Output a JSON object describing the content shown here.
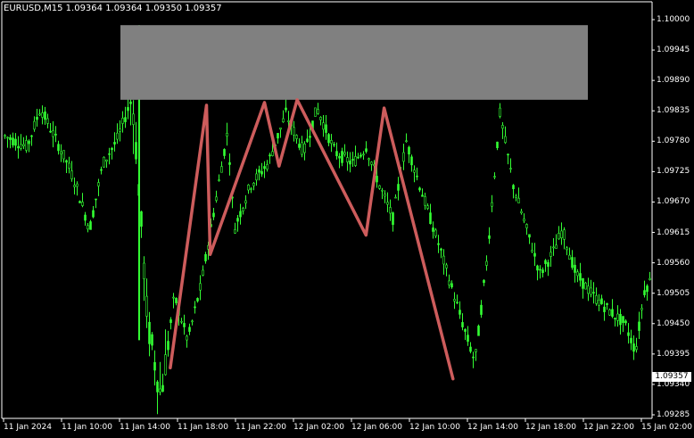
{
  "symbol_info": {
    "text": "EURUSD,M15  1.09364 1.09364 1.09350 1.09357"
  },
  "price_axis": {
    "ticks": [
      "1.10000",
      "1.09945",
      "1.09890",
      "1.09835",
      "1.09780",
      "1.09725",
      "1.09670",
      "1.09615",
      "1.09560",
      "1.09505",
      "1.09450",
      "1.09395",
      "1.09340",
      "1.09285"
    ],
    "current_price": "1.09357"
  },
  "time_axis": {
    "ticks": [
      "11 Jan 2024",
      "11 Jan 10:00",
      "11 Jan 14:00",
      "11 Jan 18:00",
      "11 Jan 22:00",
      "12 Jan 02:00",
      "12 Jan 06:00",
      "12 Jan 10:00",
      "12 Jan 14:00",
      "12 Jan 18:00",
      "12 Jan 22:00",
      "15 Jan 02:00"
    ]
  },
  "colors": {
    "background": "#000000",
    "candle": "#33ff33",
    "zigzag": "#cd5c5c",
    "zone": "#808080",
    "axis": "#ffffff",
    "text": "#ffffff"
  },
  "chart_data": {
    "type": "candlestick",
    "symbol": "EURUSD",
    "timeframe": "M15",
    "ohlc_last": {
      "open": 1.09364,
      "high": 1.09364,
      "low": 1.0935,
      "close": 1.09357
    },
    "ylim": [
      1.09285,
      1.1
    ],
    "resistance_zone": {
      "price_low": 1.09855,
      "price_high": 1.0999
    },
    "zigzag_pattern": [
      {
        "time": "11 Jan 17:30",
        "price": 1.0937
      },
      {
        "time": "11 Jan 20:00",
        "price": 1.09845
      },
      {
        "time": "11 Jan 20:15",
        "price": 1.09575
      },
      {
        "time": "12 Jan 00:00",
        "price": 1.0985
      },
      {
        "time": "12 Jan 01:00",
        "price": 1.09735
      },
      {
        "time": "12 Jan 02:15",
        "price": 1.09855
      },
      {
        "time": "12 Jan 07:00",
        "price": 1.0961
      },
      {
        "time": "12 Jan 08:15",
        "price": 1.0984
      },
      {
        "time": "12 Jan 13:00",
        "price": 1.0935
      }
    ]
  }
}
